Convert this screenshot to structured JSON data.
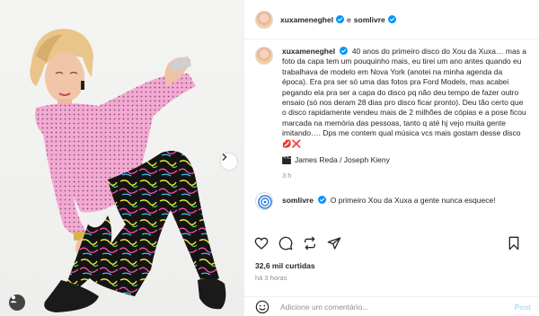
{
  "header": {
    "user1": "xuxameneghel",
    "conjunction": "e",
    "user2": "somlivre"
  },
  "caption": {
    "username": "xuxameneghel",
    "text": "40 anos do primeiro disco do Xou da Xuxa… mas a foto da capa tem um pouquinho mais, eu tirei um ano antes quando eu trabalhava de modelo em Nova York (anotei na minha agenda da época). Era pra ser só uma das fotos pra Ford Models, mas acabei pegando ela pra ser a capa do disco pq não deu tempo de fazer outro ensaio (só nos deram 28 dias pro disco ficar pronto). Deu tão certo que o disco rapidamente vendeu mais de 2 milhões de cópias e a pose ficou marcada na memória das pessoas, tanto q até hj vejo muita gente imitando…. Dps me contem qual música vcs mais gostam desse disco 💋❌",
    "credits": "James Reda / Joseph Kieny",
    "time": "3 h"
  },
  "comment2": {
    "username": "somlivre",
    "text": "O primeiro Xou da Xuxa a gente nunca esquece!"
  },
  "icons": {
    "actions": [
      "heart-icon",
      "comment-icon",
      "repost-icon",
      "share-icon",
      "bookmark-icon"
    ],
    "verified": "verified-badge-icon",
    "clapper": "clapperboard-icon"
  },
  "likes": "32,6 mil curtidas",
  "ago": "há 3 horas",
  "add_comment": {
    "placeholder": "Adicione um comentário...",
    "post_label": "Post"
  },
  "colors": {
    "verified": "#0095f6",
    "post_disabled": "#b2dffc",
    "secondary_text": "#8e8e8e"
  }
}
